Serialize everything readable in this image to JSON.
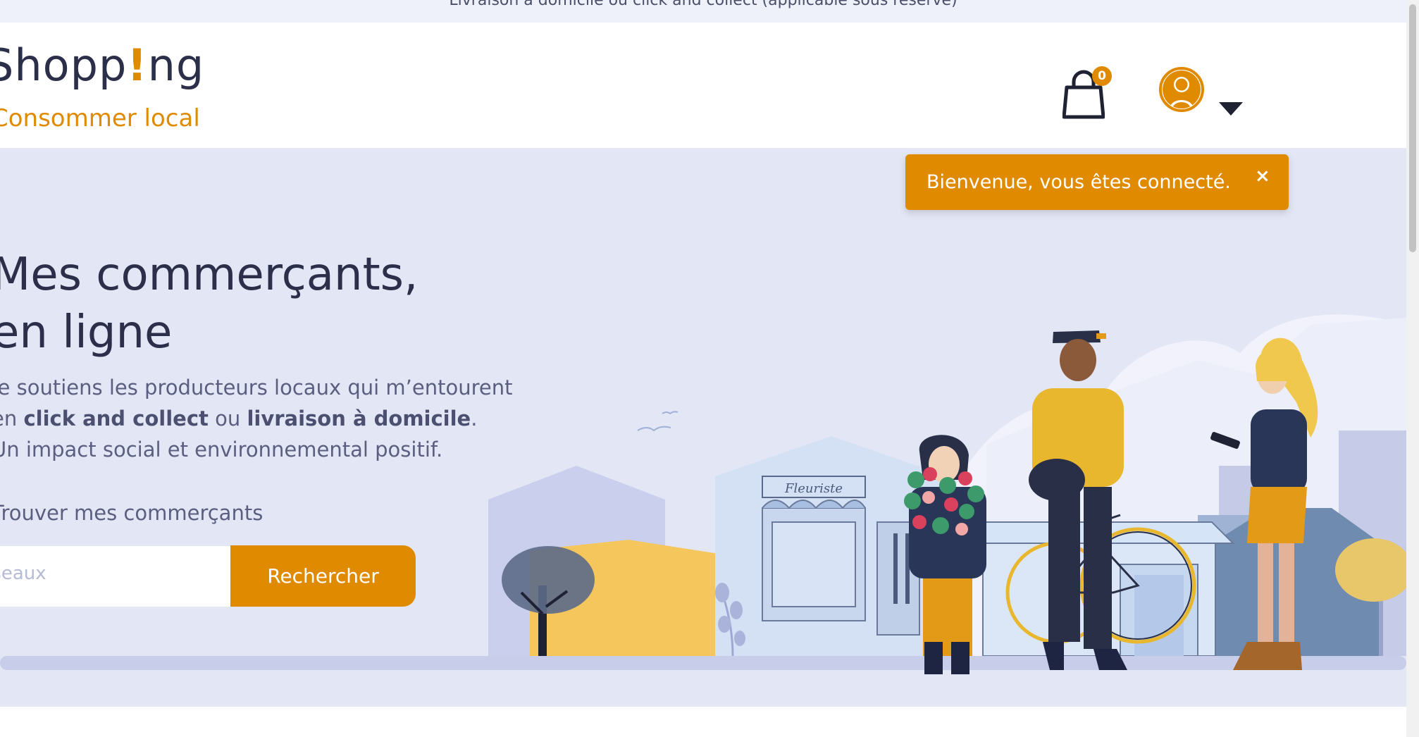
{
  "topbar": {
    "text": "Livraison à domicile ou click and collect (applicable sous réserve)"
  },
  "header": {
    "logo": {
      "word_start": "Shopp",
      "word_bang": "!",
      "word_end": "ng",
      "tagline": "Consommer local"
    },
    "cart": {
      "count": "0"
    },
    "user": {
      "avatar": "user-avatar-icon"
    }
  },
  "hero": {
    "title_line1": "Mes commerçants,",
    "title_line2": "en ligne",
    "desc": {
      "line1": "Je soutiens les producteurs locaux qui m’entourent",
      "line2_a": "en ",
      "line2_b": "click and collect",
      "line2_c": " ou ",
      "line2_d": "livraison à domicile",
      "line2_e": ".",
      "line3": "Un impact social et environnemental positif."
    },
    "search": {
      "label": "Trouver mes commerçants",
      "placeholder": "Ville, code postal, réseaux",
      "button": "Rechercher"
    },
    "illustration": {
      "shop_sign": "Fleuriste"
    }
  },
  "toast": {
    "message": "Bienvenue, vous êtes connecté.",
    "close": "×"
  },
  "colors": {
    "accent": "#e08a00",
    "hero_bg": "#e3e6f5",
    "text_dark": "#2b2f4a"
  }
}
